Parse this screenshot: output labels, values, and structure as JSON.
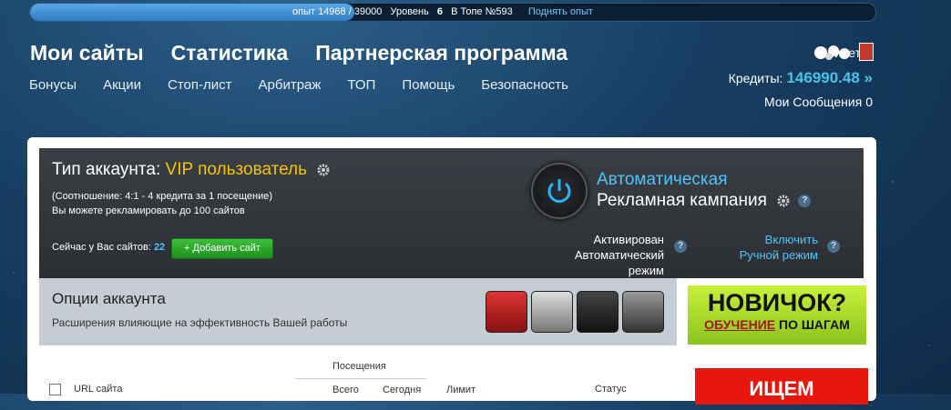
{
  "topbar": {
    "exp_label": "опыт 14968 / 39000",
    "level_label": "Уровень",
    "level": "6",
    "rank": "В Топе №593",
    "raise": "Поднять опыт",
    "exp_progress": 0.3838
  },
  "main_nav": [
    "Мои сайты",
    "Статистика",
    "Партнерская программа"
  ],
  "sub_nav": [
    "Бонусы",
    "Акции",
    "Стоп-лист",
    "Арбитраж",
    "ТОП",
    "Помощь",
    "Безопасность"
  ],
  "user": {
    "greeting": "Привет, р",
    "credits_label": "Кредиты:",
    "credits": "146990.48 »",
    "messages": "Мои Сообщения 0"
  },
  "account": {
    "type_label": "Тип аккаунта:",
    "type_value": "VIP пользователь",
    "ratio": "(Соотношение: 4:1 - 4 кредита за 1 посещение)",
    "limit": "Вы можете рекламировать до 100 сайтов",
    "sites_label": "Сейчас у Вас сайтов:",
    "sites_count": "22",
    "add_button": "+ Добавить сайт"
  },
  "auto": {
    "title1": "Автоматическая",
    "title2": "Рекламная кампания",
    "activated": "Активирован",
    "auto_mode": "Автоматический режим",
    "enable": "Включить",
    "manual_mode": "Ручной режим"
  },
  "options": {
    "title": "Опции аккаунта",
    "subtitle": "Расширения влияющие на эффективность Вашей работы"
  },
  "newbie": {
    "big": "НОВИЧОК?",
    "learn": "ОБУЧЕНИЕ",
    "rest": "ПО ШАГАМ"
  },
  "table": {
    "visits": "Посещения",
    "url": "URL сайта",
    "total": "Всего",
    "today": "Сегодня",
    "limit": "Лимит",
    "status": "Статус"
  },
  "search_banner": "ИЩЕМ",
  "colors": {
    "accent": "#4fc3f7",
    "vip": "#f5c400",
    "green": "#2eaa2e"
  }
}
